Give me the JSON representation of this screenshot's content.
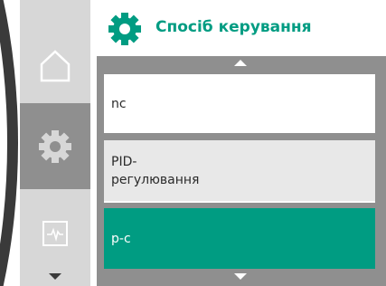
{
  "header": {
    "title": "Спосіб керування",
    "icon": "gear-icon",
    "accent_color": "#009c82"
  },
  "nav": {
    "items": [
      {
        "icon": "home-icon",
        "selected": false
      },
      {
        "icon": "gear-icon",
        "selected": true
      },
      {
        "icon": "diagnostics-icon",
        "selected": false
      }
    ],
    "scroll_down_icon": "chevron-down-icon"
  },
  "options": [
    {
      "label": "nc",
      "selected": false
    },
    {
      "label": "PID-\nрегулювання",
      "selected": false
    },
    {
      "label": "p-c",
      "selected": true
    }
  ]
}
